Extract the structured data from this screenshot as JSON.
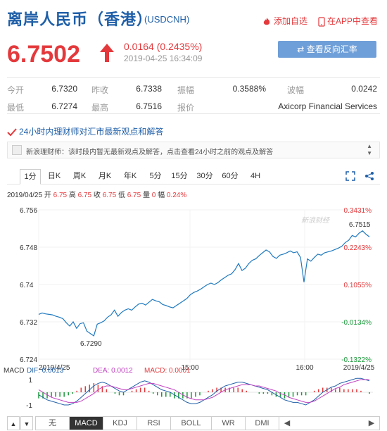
{
  "header": {
    "title": "离岸人民币（香港）",
    "symbol": "(USDCNH)",
    "add_favorite": "添加自选",
    "app_view": "在APP中查看"
  },
  "quote": {
    "price": "6.7502",
    "change": "0.0164 (0.2435%)",
    "timestamp": "2019-04-25 16:34:09",
    "reverse_button": "查看反向汇率 CNHUSD"
  },
  "stats": {
    "open_label": "今开",
    "open": "6.7320",
    "prev_close_label": "昨收",
    "prev_close": "6.7338",
    "amplitude_label": "振幅",
    "amplitude": "0.3588%",
    "range_label": "波幅",
    "range": "0.0242",
    "low_label": "最低",
    "low": "6.7274",
    "high_label": "最高",
    "high": "6.7516",
    "quoter_label": "报价",
    "quoter": "Axicorp Financial Services"
  },
  "analysis": {
    "title": "24小时内理财师对汇市最新观点和解答",
    "notice": "新浪理财师：该时段内暂无最新观点及解答，点击查看24小时之前的观点及解答"
  },
  "tabs": [
    "1分",
    "日K",
    "周K",
    "月K",
    "年K",
    "5分",
    "15分",
    "30分",
    "60分",
    "4H"
  ],
  "ohlc": {
    "date": "2019/04/25",
    "open_label": "开",
    "open": "6.75",
    "high_label": "高",
    "high": "6.75",
    "close_label": "收",
    "close": "6.75",
    "low_label": "低",
    "low": "6.75",
    "volume_label": "量",
    "volume": "0",
    "amp_label": "幅",
    "amp": "0.24%"
  },
  "chart_data": {
    "type": "line",
    "watermark": "新浪财经",
    "y_ticks": [
      "6.756",
      "6.748",
      "6.74",
      "6.732",
      "6.724"
    ],
    "pct_ticks": [
      "0.3431%",
      "0.2243%",
      "0.1055%",
      "-0.0134%",
      "-0.1322%"
    ],
    "x_ticks": [
      "2019/4/25",
      "15:00",
      "16:00",
      "2019/4/25"
    ],
    "ylim": [
      6.724,
      6.756
    ],
    "annotations": [
      {
        "label": "6.7515",
        "y": 6.7515
      },
      {
        "label": "6.7290",
        "y": 6.729
      }
    ],
    "series": [
      {
        "values": [
          6.7336,
          6.7339,
          6.7337,
          6.7336,
          6.7335,
          6.7332,
          6.733,
          6.7327,
          6.7318,
          6.7311,
          6.732,
          6.7306,
          6.7316,
          6.7318,
          6.73,
          6.7295,
          6.729,
          6.7315,
          6.7318,
          6.7322,
          6.733,
          6.7335,
          6.7345,
          6.7332,
          6.734,
          6.7345,
          6.7348,
          6.7345,
          6.7352,
          6.7358,
          6.736,
          6.7356,
          6.7362,
          6.7368,
          6.7365,
          6.7363,
          6.7357,
          6.7355,
          6.7352,
          6.735,
          6.7355,
          6.736,
          6.7365,
          6.737,
          6.7378,
          6.7383,
          6.7386,
          6.739,
          6.7395,
          6.74,
          6.7403,
          6.74,
          6.7404,
          6.741,
          6.7415,
          6.742,
          6.7423,
          6.7432,
          6.7445,
          6.743,
          6.7435,
          6.7445,
          6.7452,
          6.7455,
          6.7462,
          6.7468,
          6.7474,
          6.747,
          6.746,
          6.7456,
          6.7463,
          6.7465,
          6.7468,
          6.7472,
          6.7468,
          6.747,
          6.7458,
          6.7405,
          6.7455,
          6.745,
          6.7458,
          6.7465,
          6.7463,
          6.7468,
          6.747,
          6.7472,
          6.7475,
          6.7478,
          6.7482,
          6.749,
          6.7495,
          6.7505,
          6.7502,
          6.751,
          6.7515,
          6.7508,
          6.7502
        ]
      }
    ]
  },
  "macd": {
    "label": "MACD",
    "dif_label": "DIF: 0.0013",
    "dea_label": "DEA: 0.0012",
    "macd_label": "MACD: 0.0001",
    "y_ticks": [
      "1",
      "-1"
    ],
    "dif": [
      -0.2,
      -0.4,
      -0.6,
      -0.7,
      -0.8,
      -0.9,
      -1.0,
      -1.0,
      -0.9,
      -0.7,
      -0.4,
      -0.1,
      0.2,
      0.5,
      0.7,
      0.8,
      0.7,
      0.5,
      0.3,
      0.1,
      0.0,
      0.2,
      0.4,
      0.6,
      0.8,
      0.9,
      0.8,
      0.6,
      0.4,
      0.2,
      0.1,
      0.0,
      -0.2,
      -0.4,
      -0.6,
      -0.8,
      -0.9,
      -0.9,
      -0.8,
      -0.6,
      -0.4,
      -0.2,
      0.1,
      0.3,
      0.5,
      0.6,
      0.7,
      0.8,
      0.8,
      0.7,
      0.6,
      0.5,
      0.4,
      0.3,
      0.2,
      0.0,
      -0.2,
      -0.4,
      -0.6,
      -0.7,
      -0.8,
      -0.8,
      -0.9,
      -1.0,
      -0.8,
      -0.6,
      -0.3,
      0.0,
      0.2,
      0.4,
      0.5,
      0.7,
      0.8,
      0.9,
      1.0,
      1.1,
      1.1,
      1.0,
      0.9
    ],
    "dea": [
      0.2,
      0.0,
      -0.2,
      -0.4,
      -0.5,
      -0.6,
      -0.7,
      -0.8,
      -0.8,
      -0.8,
      -0.7,
      -0.5,
      -0.3,
      -0.1,
      0.2,
      0.4,
      0.5,
      0.5,
      0.4,
      0.3,
      0.2,
      0.2,
      0.3,
      0.4,
      0.5,
      0.6,
      0.7,
      0.7,
      0.6,
      0.5,
      0.4,
      0.3,
      0.2,
      0.0,
      -0.2,
      -0.4,
      -0.5,
      -0.6,
      -0.6,
      -0.6,
      -0.5,
      -0.4,
      -0.2,
      0.0,
      0.2,
      0.3,
      0.4,
      0.5,
      0.6,
      0.6,
      0.6,
      0.5,
      0.5,
      0.4,
      0.3,
      0.2,
      0.1,
      -0.1,
      -0.2,
      -0.4,
      -0.5,
      -0.6,
      -0.7,
      -0.8,
      -0.8,
      -0.7,
      -0.5,
      -0.3,
      -0.1,
      0.1,
      0.3,
      0.4,
      0.6,
      0.7,
      0.8,
      0.9,
      1.0,
      1.0,
      1.0
    ]
  },
  "bottom_tabs": [
    "无",
    "MACD",
    "KDJ",
    "RSI",
    "BOLL",
    "WR",
    "DMI"
  ],
  "nav": [
    "▲",
    "▼",
    "◀",
    "▶"
  ]
}
